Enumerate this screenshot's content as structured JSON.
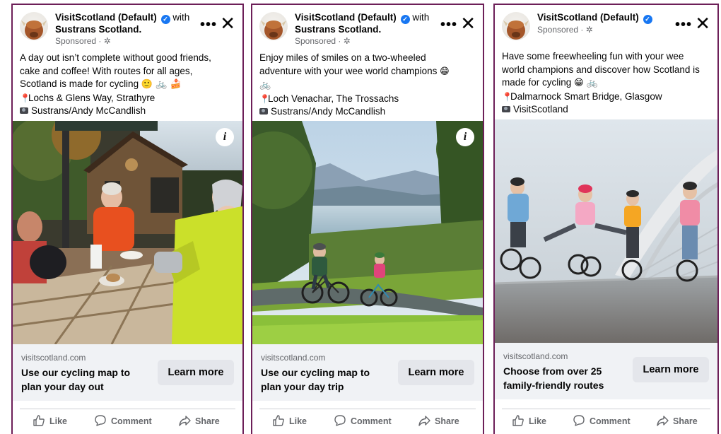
{
  "cards": [
    {
      "page_name": "VisitScotland (Default)",
      "verified_mark": "✓",
      "with_word": "with",
      "partner_name": "Sustrans Scotland.",
      "sponsored": "Sponsored · ✲",
      "more_label": "•••",
      "close_label": "✕",
      "body": {
        "line1": "A day out isn’t complete without good friends,",
        "line2": "cake and coffee! With routes for all ages,",
        "line3": "Scotland is made for cycling",
        "line3_emoji": "🙂 🚲 🍰",
        "location": "Lochs & Glens Way, Strathyre",
        "credit": "Sustrans/Andy McCandlish"
      },
      "info_label": "i",
      "domain": "visitscotland.com",
      "headline": "Use our cycling map to plan your day out",
      "cta": "Learn more"
    },
    {
      "page_name": "VisitScotland (Default)",
      "verified_mark": "✓",
      "with_word": "with",
      "partner_name": "Sustrans Scotland.",
      "sponsored": "Sponsored · ✲",
      "more_label": "•••",
      "close_label": "✕",
      "body": {
        "line1": "Enjoy miles of smiles on a two-wheeled",
        "line2": "adventure with your wee world champions",
        "line2_emoji": "😁",
        "line3_emoji": "🚲",
        "location": "Loch Venachar, The Trossachs",
        "credit": "Sustrans/Andy McCandlish"
      },
      "info_label": "i",
      "domain": "visitscotland.com",
      "headline": "Use our cycling map to plan your day trip",
      "cta": "Learn more"
    },
    {
      "page_name": "VisitScotland (Default)",
      "verified_mark": "✓",
      "sponsored": "Sponsored · ✲",
      "more_label": "•••",
      "close_label": "✕",
      "body": {
        "line1": "Have some freewheeling fun with your wee",
        "line2": "world champions and discover how Scotland is",
        "line3": "made for cycling",
        "line3_emoji": "😁 🚲",
        "location": "Dalmarnock Smart Bridge, Glasgow",
        "credit": "VisitScotland"
      },
      "domain": "visitscotland.com",
      "headline": "Choose from over 25 family-friendly routes",
      "cta": "Learn more"
    }
  ],
  "actions": {
    "like": "Like",
    "comment": "Comment",
    "share": "Share"
  }
}
